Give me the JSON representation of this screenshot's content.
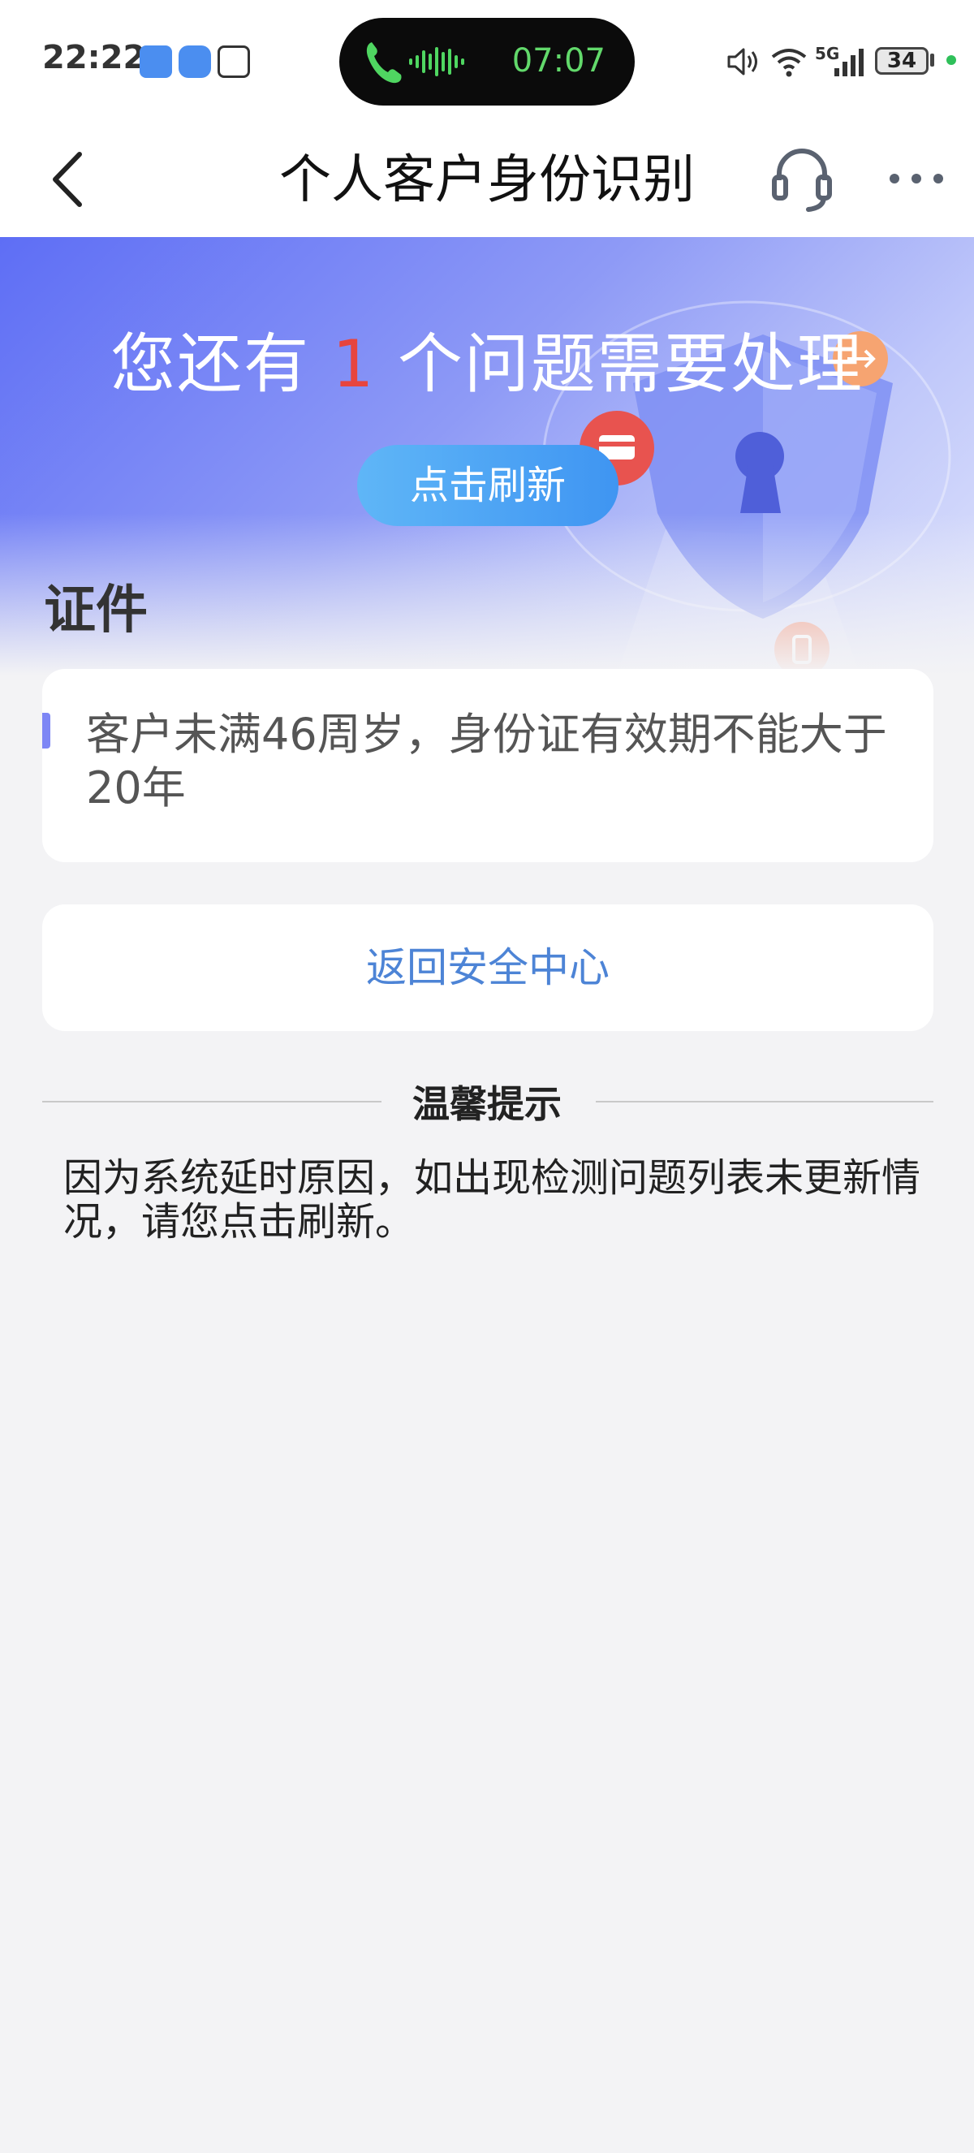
{
  "status_bar": {
    "time": "22:22",
    "call_timer": "07:07",
    "network": "5G",
    "battery": "34"
  },
  "nav": {
    "title": "个人客户身份识别"
  },
  "hero": {
    "title_prefix": "您还有",
    "issue_count": "1",
    "title_suffix": "个问题需要处理",
    "refresh_label": "点击刷新"
  },
  "section": {
    "title": "证件"
  },
  "issue": {
    "message": "客户未满46周岁，身份证有效期不能大于20年"
  },
  "back_button": {
    "label": "返回安全中心"
  },
  "tips": {
    "title": "温馨提示",
    "text": "因为系统延时原因，如出现检测问题列表未更新情况，请您点击刷新。"
  },
  "colors": {
    "hero_gradient_start": "#5e6ef5",
    "issue_count": "#e7453e",
    "refresh_button": "#3f95f2",
    "link_blue": "#4d84d6",
    "accent_bar": "#7d86f5"
  }
}
